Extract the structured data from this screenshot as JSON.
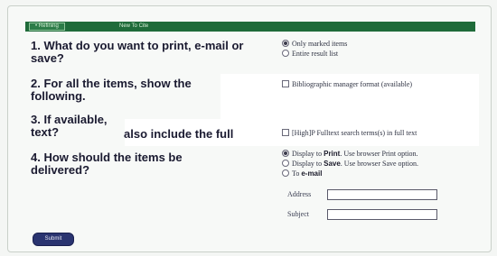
{
  "nav": {
    "tabs": [
      {
        "label": "• Refining"
      },
      {
        "label": "New To Cite"
      }
    ]
  },
  "questions": [
    {
      "label": "1. What do you want to print, e-mail or save?"
    },
    {
      "label": "2. For all the items, show the following."
    },
    {
      "label_part1": "3. If available,",
      "label_part2": "text?",
      "label_part3": "also include the full"
    },
    {
      "label": "4. How should the items be delivered?"
    }
  ],
  "q1_options": [
    {
      "label": "Only marked items",
      "selected": true
    },
    {
      "label": "Entire result list",
      "selected": false
    }
  ],
  "q2_option": {
    "label": "Bibliographic manager format (available)",
    "checked": false
  },
  "q3_option": {
    "label": "[High]P  Fulltext search terms(s) in full text",
    "checked": false
  },
  "q4_options": [
    {
      "prefix": "Display to ",
      "emph": "Print",
      "suffix": ". Use browser Print option.",
      "selected": true
    },
    {
      "prefix": "Display to ",
      "emph": "Save",
      "suffix": ". Use browser Save option.",
      "selected": false
    },
    {
      "prefix": "To ",
      "emph": "e-mail",
      "suffix": "",
      "selected": false
    }
  ],
  "email_fields": {
    "address_label": "Address",
    "subject_label": "Subject"
  },
  "submit_label": "Submit"
}
